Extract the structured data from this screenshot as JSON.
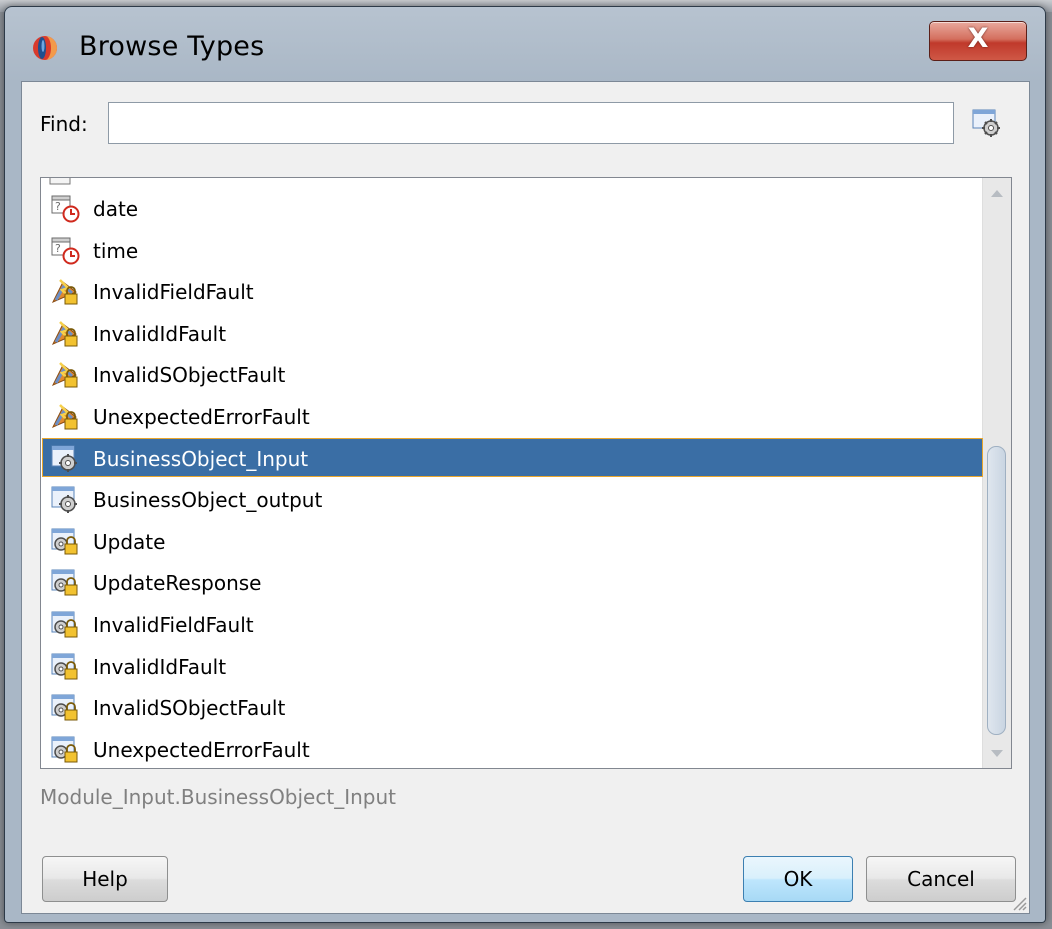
{
  "window": {
    "title": "Browse Types",
    "close_label": "X"
  },
  "find": {
    "label": "Find:",
    "value": "",
    "placeholder": ""
  },
  "list": {
    "items": [
      {
        "label": "date",
        "icon": "date-time-type-icon"
      },
      {
        "label": "time",
        "icon": "date-time-type-icon"
      },
      {
        "label": "InvalidFieldFault",
        "icon": "locked-fault-icon"
      },
      {
        "label": "InvalidIdFault",
        "icon": "locked-fault-icon"
      },
      {
        "label": "InvalidSObjectFault",
        "icon": "locked-fault-icon"
      },
      {
        "label": "UnexpectedErrorFault",
        "icon": "locked-fault-icon"
      },
      {
        "label": "BusinessObject_Input",
        "icon": "gear-element-icon",
        "selected": true
      },
      {
        "label": "BusinessObject_output",
        "icon": "gear-element-icon"
      },
      {
        "label": "Update",
        "icon": "locked-gear-element-icon"
      },
      {
        "label": "UpdateResponse",
        "icon": "locked-gear-element-icon"
      },
      {
        "label": "InvalidFieldFault",
        "icon": "locked-gear-element-icon"
      },
      {
        "label": "InvalidIdFault",
        "icon": "locked-gear-element-icon"
      },
      {
        "label": "InvalidSObjectFault",
        "icon": "locked-gear-element-icon"
      },
      {
        "label": "UnexpectedErrorFault",
        "icon": "locked-gear-element-icon"
      }
    ]
  },
  "status_text": "Module_Input.BusinessObject_Input",
  "buttons": {
    "help": "Help",
    "ok": "OK",
    "cancel": "Cancel"
  },
  "colors": {
    "selection_bg": "#3a6ea5",
    "selection_border": "#e8a62d",
    "close_button": "#c0392b"
  }
}
